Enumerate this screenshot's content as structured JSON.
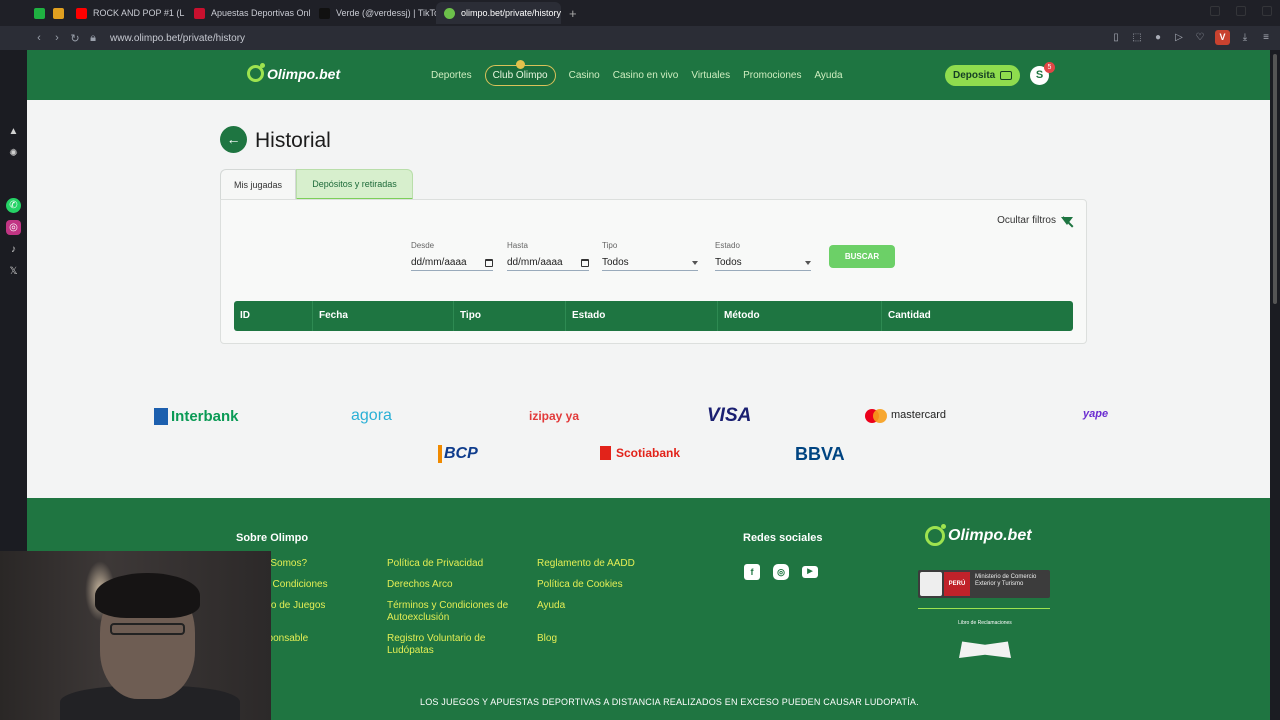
{
  "browser": {
    "tabs": [
      {
        "label": "",
        "color": "#1fb141"
      },
      {
        "label": "",
        "color": "#e0a020"
      },
      {
        "label": "ROCK AND POP #1 (L",
        "color": "#ff0000"
      },
      {
        "label": "Apuestas Deportivas Onl",
        "color": "#c8102e"
      },
      {
        "label": "Verde (@verdessj) | TikTo",
        "color": "#111111"
      },
      {
        "label": "olimpo.bet/private/history",
        "color": "#6cc04a"
      }
    ],
    "url": "www.olimpo.bet/private/history",
    "profile_initial": "V"
  },
  "header": {
    "logo": "Olimpo.bet",
    "nav": [
      "Deportes",
      "Club Olimpo",
      "Casino",
      "Casino en vivo",
      "Virtuales",
      "Promociones",
      "Ayuda"
    ],
    "deposit_label": "Deposita",
    "avatar_initial": "S",
    "notification_count": "5"
  },
  "history": {
    "title": "Historial",
    "tabs": [
      "Mis jugadas",
      "Depósitos y retiradas"
    ],
    "hide_filters": "Ocultar filtros",
    "filters": {
      "from_label": "Desde",
      "from_value": "dd/mm/aaaa",
      "to_label": "Hasta",
      "to_value": "dd/mm/aaaa",
      "type_label": "Tipo",
      "type_value": "Todos",
      "state_label": "Estado",
      "state_value": "Todos",
      "search_button": "BUSCAR"
    },
    "columns": [
      "ID",
      "Fecha",
      "Tipo",
      "Estado",
      "Método",
      "Cantidad"
    ]
  },
  "payment_logos": [
    {
      "name": "Interbank",
      "color": "#0a9a55"
    },
    {
      "name": "agora",
      "color": "#2ab0d6"
    },
    {
      "name": "izipay ya",
      "color": "#e23a3a"
    },
    {
      "name": "VISA",
      "color": "#1a1f71"
    },
    {
      "name": "mastercard",
      "color": "#222222"
    },
    {
      "name": "yape",
      "color": "#6a2bd1"
    },
    {
      "name": "BCP",
      "color": "#0f3c8c"
    },
    {
      "name": "Scotiabank",
      "color": "#e2231a"
    },
    {
      "name": "BBVA",
      "color": "#004481"
    }
  ],
  "footer": {
    "about_heading": "Sobre Olimpo",
    "col1": [
      "es Somos?",
      "s y Condiciones",
      "ento de Juegos",
      "esponsable"
    ],
    "col2": [
      "Política de Privacidad",
      "Derechos Arco",
      "Términos y Condiciones de Autoexclusión",
      "Registro Voluntario de Ludópatas"
    ],
    "col3": [
      "Reglamento de AADD",
      "Política de Cookies",
      "Ayuda",
      "Blog"
    ],
    "social_heading": "Redes sociales",
    "logo": "Olimpo.bet",
    "mincetur_peru": "PERÚ",
    "mincetur_text": "Ministerio de Comercio Exterior y Turismo",
    "book_text": "Libro de Reclamaciones",
    "disclaimer": "LOS JUEGOS Y APUESTAS DEPORTIVAS A DISTANCIA REALIZADOS EN EXCESO PUEDEN CAUSAR LUDOPATÍA."
  },
  "colors": {
    "brand_green": "#1e7541",
    "accent_lime": "#8fdc4e",
    "link_yellow": "#e4ee55"
  }
}
